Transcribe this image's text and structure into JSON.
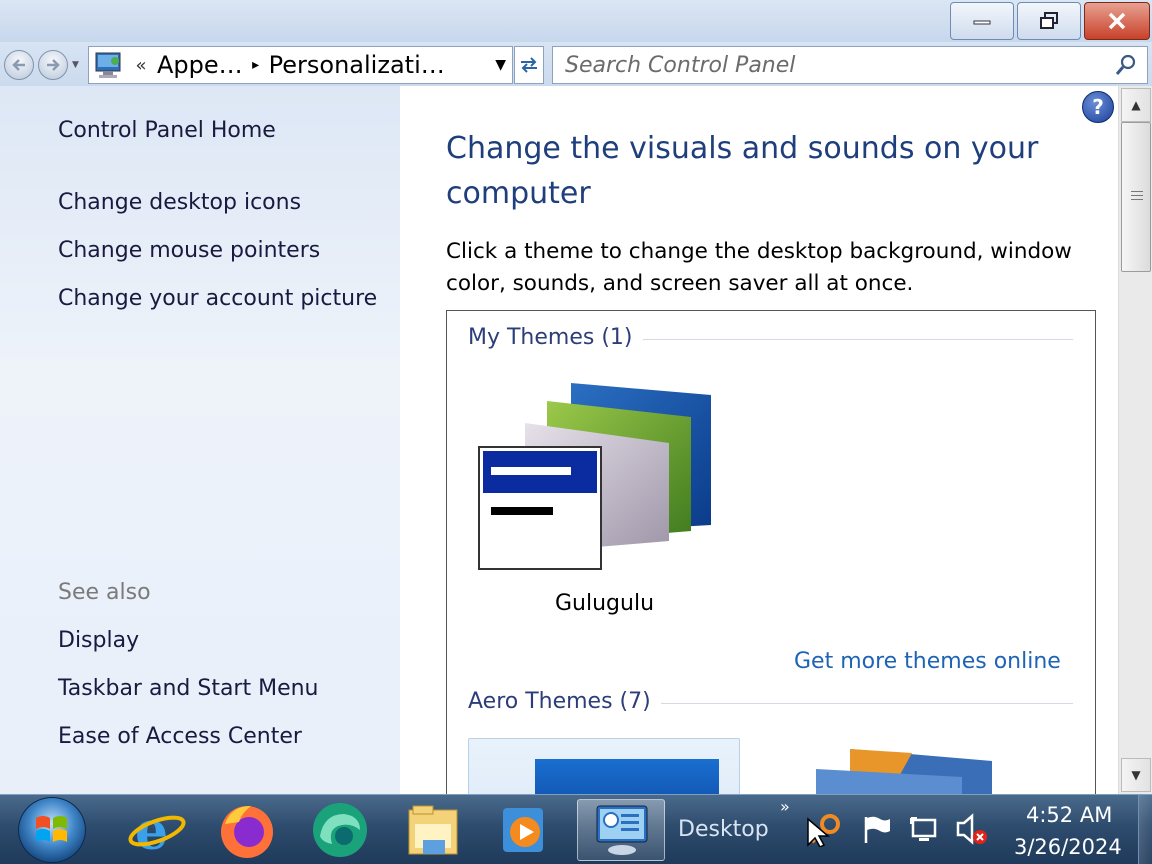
{
  "window": {
    "minimize_icon": "minimize-icon",
    "restore_icon": "restore-icon",
    "close_icon": "close-icon"
  },
  "address": {
    "overflow": "«",
    "segments": [
      "Appe…",
      "Personalizati…"
    ],
    "separator": "▸"
  },
  "search": {
    "placeholder": "Search Control Panel"
  },
  "sidebar": {
    "home": "Control Panel Home",
    "tasks": [
      "Change desktop icons",
      "Change mouse pointers",
      "Change your account picture"
    ],
    "see_also_label": "See also",
    "see_also": [
      "Display",
      "Taskbar and Start Menu",
      "Ease of Access Center"
    ]
  },
  "main": {
    "help_glyph": "?",
    "title": "Change the visuals and sounds on your computer",
    "description": "Click a theme to change the desktop background, window color, sounds, and screen saver all at once.",
    "my_themes_header": "My Themes (1)",
    "my_theme_name": "Gulugulu",
    "get_more_link": "Get more themes online",
    "aero_themes_header": "Aero Themes (7)"
  },
  "taskbar": {
    "apps": [
      "internet-explorer-icon",
      "firefox-icon",
      "edge-icon",
      "file-explorer-icon",
      "media-player-icon",
      "control-panel-icon"
    ],
    "desktop_label": "Desktop",
    "chevron": "»",
    "clock_time": "4:52 AM",
    "clock_date": "3/26/2024"
  },
  "colors": {
    "title_blue": "#1e3f7c",
    "link_blue": "#1e64b4",
    "section_blue": "#2c3e7a",
    "taskbar": "#2e4c6e"
  }
}
